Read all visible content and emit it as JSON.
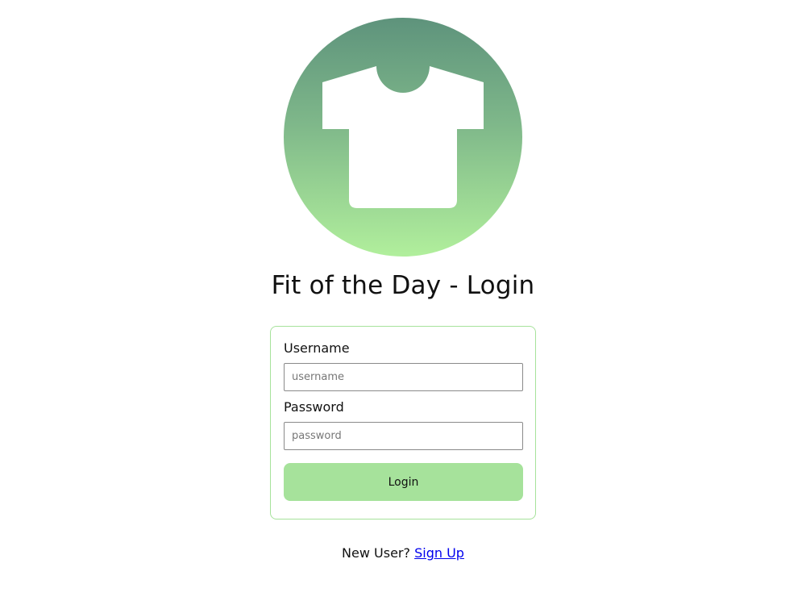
{
  "logo": {
    "icon": "t-shirt-icon",
    "gradient_top": "#5e937c",
    "gradient_bottom": "#b1ef9c",
    "icon_color": "#ffffff"
  },
  "header": {
    "title": "Fit of the Day - Login"
  },
  "form": {
    "border_color": "#a6e29b",
    "username_label": "Username",
    "username_placeholder": "username",
    "username_value": "",
    "password_label": "Password",
    "password_placeholder": "password",
    "password_value": "",
    "login_label": "Login",
    "login_color": "#a6e29b"
  },
  "footer": {
    "prompt": "New User?",
    "signup_label": "Sign Up",
    "link_color": "#0000ee"
  }
}
